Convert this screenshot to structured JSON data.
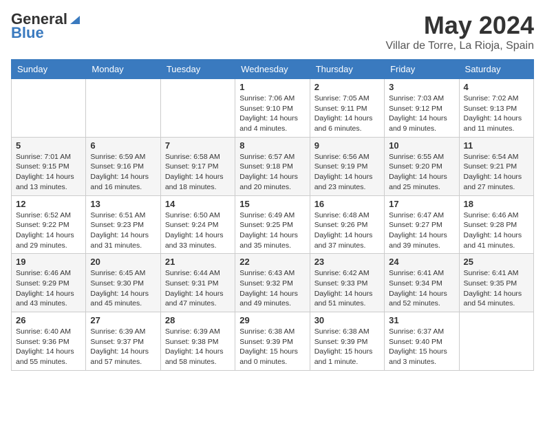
{
  "header": {
    "logo_general": "General",
    "logo_blue": "Blue",
    "title": "May 2024",
    "subtitle": "Villar de Torre, La Rioja, Spain"
  },
  "days_of_week": [
    "Sunday",
    "Monday",
    "Tuesday",
    "Wednesday",
    "Thursday",
    "Friday",
    "Saturday"
  ],
  "weeks": [
    {
      "days": [
        {
          "number": "",
          "info": ""
        },
        {
          "number": "",
          "info": ""
        },
        {
          "number": "",
          "info": ""
        },
        {
          "number": "1",
          "info": "Sunrise: 7:06 AM\nSunset: 9:10 PM\nDaylight: 14 hours\nand 4 minutes."
        },
        {
          "number": "2",
          "info": "Sunrise: 7:05 AM\nSunset: 9:11 PM\nDaylight: 14 hours\nand 6 minutes."
        },
        {
          "number": "3",
          "info": "Sunrise: 7:03 AM\nSunset: 9:12 PM\nDaylight: 14 hours\nand 9 minutes."
        },
        {
          "number": "4",
          "info": "Sunrise: 7:02 AM\nSunset: 9:13 PM\nDaylight: 14 hours\nand 11 minutes."
        }
      ]
    },
    {
      "days": [
        {
          "number": "5",
          "info": "Sunrise: 7:01 AM\nSunset: 9:15 PM\nDaylight: 14 hours\nand 13 minutes."
        },
        {
          "number": "6",
          "info": "Sunrise: 6:59 AM\nSunset: 9:16 PM\nDaylight: 14 hours\nand 16 minutes."
        },
        {
          "number": "7",
          "info": "Sunrise: 6:58 AM\nSunset: 9:17 PM\nDaylight: 14 hours\nand 18 minutes."
        },
        {
          "number": "8",
          "info": "Sunrise: 6:57 AM\nSunset: 9:18 PM\nDaylight: 14 hours\nand 20 minutes."
        },
        {
          "number": "9",
          "info": "Sunrise: 6:56 AM\nSunset: 9:19 PM\nDaylight: 14 hours\nand 23 minutes."
        },
        {
          "number": "10",
          "info": "Sunrise: 6:55 AM\nSunset: 9:20 PM\nDaylight: 14 hours\nand 25 minutes."
        },
        {
          "number": "11",
          "info": "Sunrise: 6:54 AM\nSunset: 9:21 PM\nDaylight: 14 hours\nand 27 minutes."
        }
      ]
    },
    {
      "days": [
        {
          "number": "12",
          "info": "Sunrise: 6:52 AM\nSunset: 9:22 PM\nDaylight: 14 hours\nand 29 minutes."
        },
        {
          "number": "13",
          "info": "Sunrise: 6:51 AM\nSunset: 9:23 PM\nDaylight: 14 hours\nand 31 minutes."
        },
        {
          "number": "14",
          "info": "Sunrise: 6:50 AM\nSunset: 9:24 PM\nDaylight: 14 hours\nand 33 minutes."
        },
        {
          "number": "15",
          "info": "Sunrise: 6:49 AM\nSunset: 9:25 PM\nDaylight: 14 hours\nand 35 minutes."
        },
        {
          "number": "16",
          "info": "Sunrise: 6:48 AM\nSunset: 9:26 PM\nDaylight: 14 hours\nand 37 minutes."
        },
        {
          "number": "17",
          "info": "Sunrise: 6:47 AM\nSunset: 9:27 PM\nDaylight: 14 hours\nand 39 minutes."
        },
        {
          "number": "18",
          "info": "Sunrise: 6:46 AM\nSunset: 9:28 PM\nDaylight: 14 hours\nand 41 minutes."
        }
      ]
    },
    {
      "days": [
        {
          "number": "19",
          "info": "Sunrise: 6:46 AM\nSunset: 9:29 PM\nDaylight: 14 hours\nand 43 minutes."
        },
        {
          "number": "20",
          "info": "Sunrise: 6:45 AM\nSunset: 9:30 PM\nDaylight: 14 hours\nand 45 minutes."
        },
        {
          "number": "21",
          "info": "Sunrise: 6:44 AM\nSunset: 9:31 PM\nDaylight: 14 hours\nand 47 minutes."
        },
        {
          "number": "22",
          "info": "Sunrise: 6:43 AM\nSunset: 9:32 PM\nDaylight: 14 hours\nand 49 minutes."
        },
        {
          "number": "23",
          "info": "Sunrise: 6:42 AM\nSunset: 9:33 PM\nDaylight: 14 hours\nand 51 minutes."
        },
        {
          "number": "24",
          "info": "Sunrise: 6:41 AM\nSunset: 9:34 PM\nDaylight: 14 hours\nand 52 minutes."
        },
        {
          "number": "25",
          "info": "Sunrise: 6:41 AM\nSunset: 9:35 PM\nDaylight: 14 hours\nand 54 minutes."
        }
      ]
    },
    {
      "days": [
        {
          "number": "26",
          "info": "Sunrise: 6:40 AM\nSunset: 9:36 PM\nDaylight: 14 hours\nand 55 minutes."
        },
        {
          "number": "27",
          "info": "Sunrise: 6:39 AM\nSunset: 9:37 PM\nDaylight: 14 hours\nand 57 minutes."
        },
        {
          "number": "28",
          "info": "Sunrise: 6:39 AM\nSunset: 9:38 PM\nDaylight: 14 hours\nand 58 minutes."
        },
        {
          "number": "29",
          "info": "Sunrise: 6:38 AM\nSunset: 9:39 PM\nDaylight: 15 hours\nand 0 minutes."
        },
        {
          "number": "30",
          "info": "Sunrise: 6:38 AM\nSunset: 9:39 PM\nDaylight: 15 hours\nand 1 minute."
        },
        {
          "number": "31",
          "info": "Sunrise: 6:37 AM\nSunset: 9:40 PM\nDaylight: 15 hours\nand 3 minutes."
        },
        {
          "number": "",
          "info": ""
        }
      ]
    }
  ]
}
